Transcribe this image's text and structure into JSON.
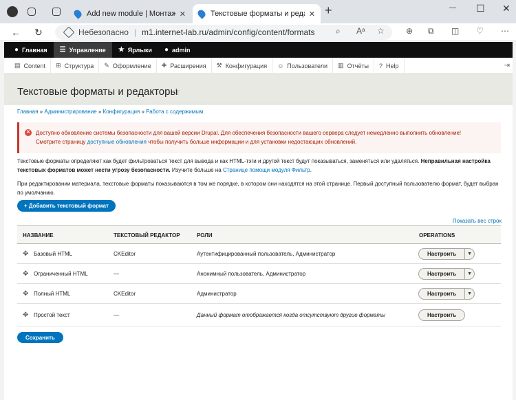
{
  "browser": {
    "tabs": [
      {
        "label": "Add new module | Монтаж и ре"
      },
      {
        "label": "Текстовые форматы и редактор"
      }
    ],
    "new_tab": "+",
    "minimize": "—",
    "maximize": "☐",
    "close": "✕",
    "url_security": "Небезопасно",
    "url": "m1.internet-lab.ru/admin/config/content/formats",
    "back": "←",
    "refresh": "↻"
  },
  "toolbar": {
    "home": "Главная",
    "manage": "Управление",
    "shortcuts": "Ярлыки",
    "user": "admin"
  },
  "menu": [
    {
      "label": "Content",
      "icon": "document-icon"
    },
    {
      "label": "Структура",
      "icon": "structure-icon"
    },
    {
      "label": "Оформление",
      "icon": "brush-icon"
    },
    {
      "label": "Расширения",
      "icon": "puzzle-icon"
    },
    {
      "label": "Конфигурация",
      "icon": "wrench-icon"
    },
    {
      "label": "Пользователи",
      "icon": "people-icon"
    },
    {
      "label": "Отчёты",
      "icon": "chart-icon"
    },
    {
      "label": "Help",
      "icon": "help-icon"
    }
  ],
  "page": {
    "title": "Текстовые форматы и редакторы",
    "breadcrumb": [
      "Главная",
      "Администрирование",
      "Конфигурация",
      "Работа с содержимым"
    ],
    "alert": {
      "text1": "Доступно обновление системы безопасности для вашей версии Drupal. Для обеспечения безопасности вашего сервера следует немедленно выполнить обновление!",
      "text2a": "Смотрите страницу ",
      "link": "доступные обновления",
      "text2b": " чтобы получить больше информации и для установки недостающих обновлений."
    },
    "p1a": "Текстовые форматы определяют как будет фильтроваться текст для вывода и как HTML-тэги и другой текст будут показываться, заменяться или удаляться. ",
    "p1b": "Неправильная настройка текстовых форматов может нести угрозу безопасности.",
    "p1c": " Изучите больше на ",
    "p1link": "Странице помощи модуля Фильтр",
    "p1d": ".",
    "p2": "При редактировании материала, текстовые форматы показываются в том же порядке, в котором они находятся на этой странице. Первый доступный пользователю формат, будет выбран по умолчанию.",
    "add_button": "+ Добавить текстовый формат",
    "show_weights": "Показать вес строк",
    "save_button": "Сохранить"
  },
  "table": {
    "headers": [
      "НАЗВАНИЕ",
      "ТЕКСТОВЫЙ РЕДАКТОР",
      "РОЛИ",
      "OPERATIONS"
    ],
    "rows": [
      {
        "name": "Базовый HTML",
        "editor": "CKEditor",
        "roles": "Аутентифицированный пользователь, Администратор",
        "op": "Настроить"
      },
      {
        "name": "Ограниченный HTML",
        "editor": "—",
        "roles": "Анонимный пользователь, Администратор",
        "op": "Настроить"
      },
      {
        "name": "Полный HTML",
        "editor": "CKEditor",
        "roles": "Администратор",
        "op": "Настроить"
      },
      {
        "name": "Простой текст",
        "editor": "—",
        "roles": "Данный формат отображается когда отсутствуют другие форматы",
        "op": "Настроить"
      }
    ]
  }
}
